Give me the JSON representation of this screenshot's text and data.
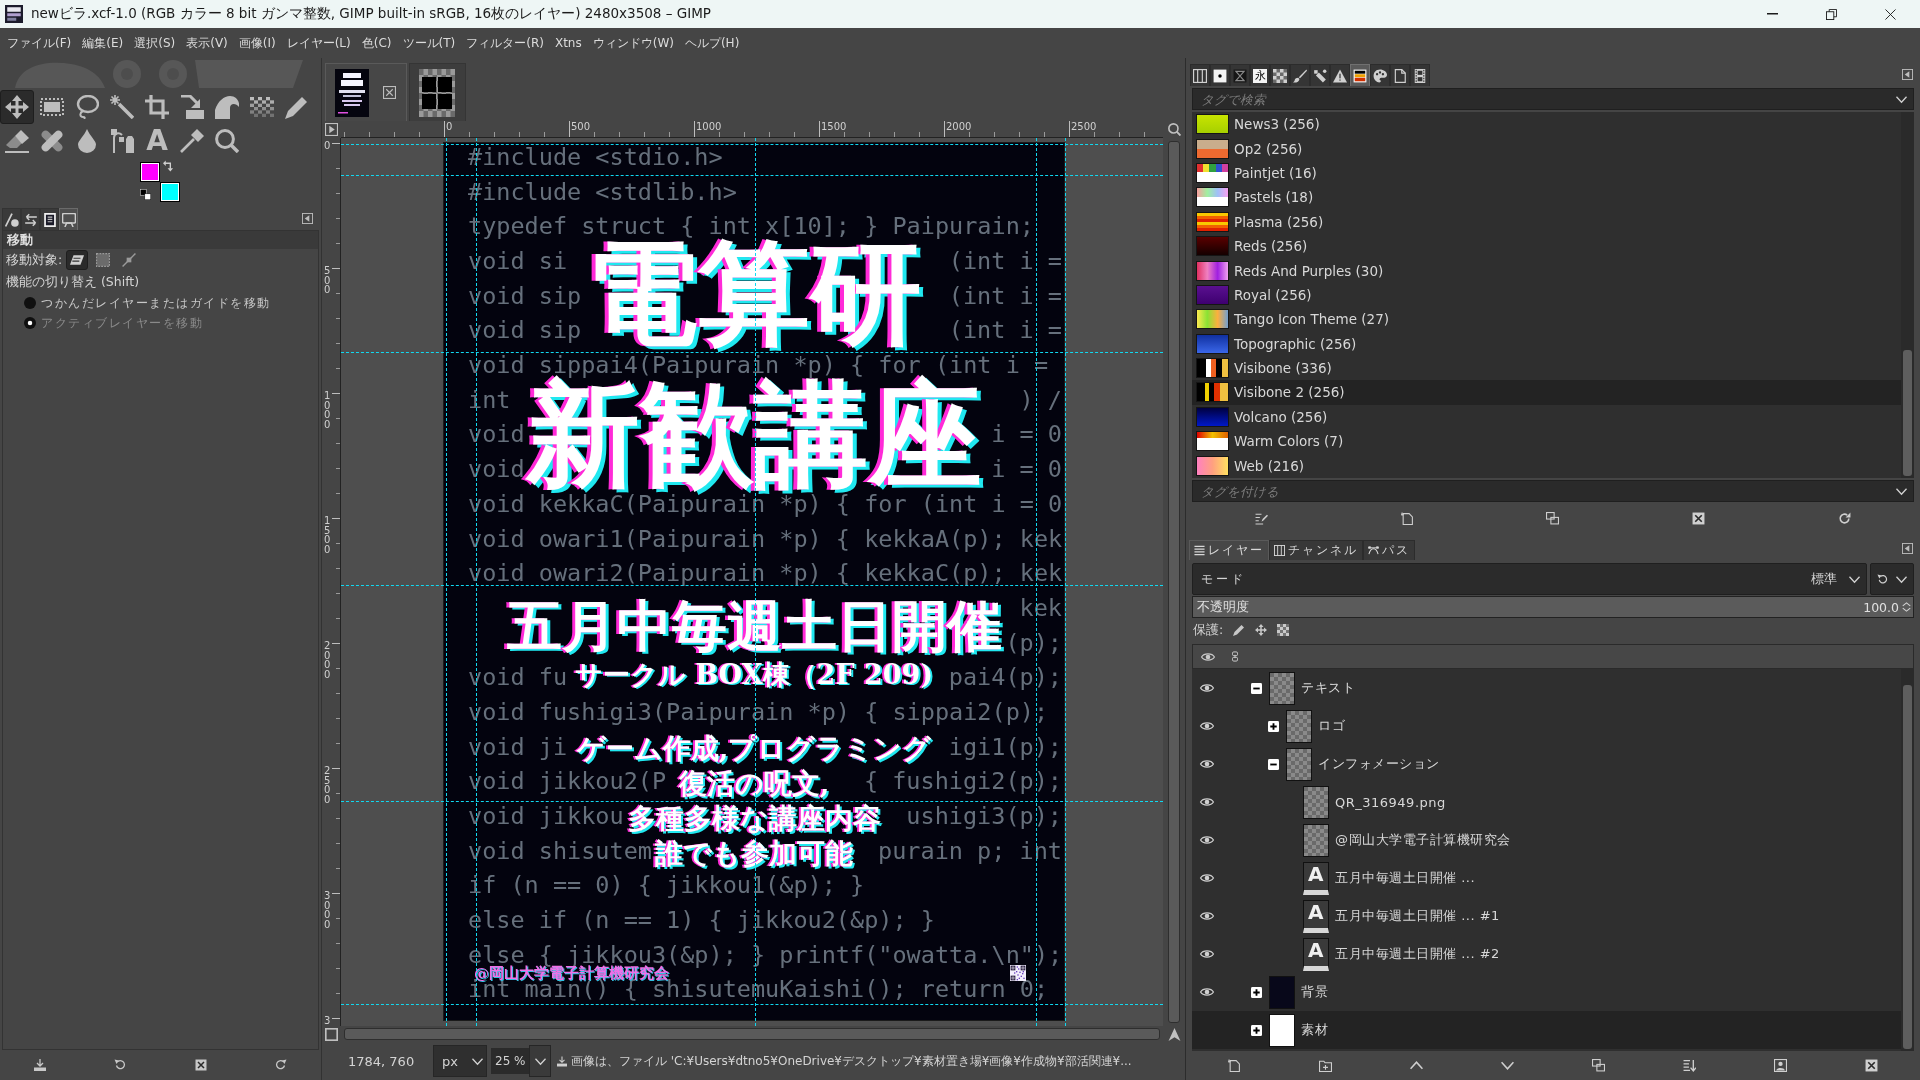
{
  "window": {
    "title": "newビラ.xcf-1.0 (RGB カラー 8 bit ガンマ整数, GIMP built-in sRGB, 16枚のレイヤー) 2480x3508 – GIMP"
  },
  "menu": [
    "ファイル(F)",
    "編集(E)",
    "選択(S)",
    "表示(V)",
    "画像(I)",
    "レイヤー(L)",
    "色(C)",
    "ツール(T)",
    "フィルター(R)",
    "Xtns",
    "ウィンドウ(W)",
    "ヘルプ(H)"
  ],
  "toolbox": {
    "tools": [
      {
        "selected": true
      },
      {
        "selected": false
      },
      {
        "selected": false
      },
      {
        "selected": false
      },
      {
        "selected": false
      },
      {
        "selected": false
      },
      {
        "selected": false
      },
      {
        "selected": false
      },
      {
        "selected": false
      },
      {
        "selected": false
      },
      {
        "selected": false
      },
      {
        "selected": false
      },
      {
        "selected": false
      },
      {
        "glyph": "A",
        "selected": false
      },
      {
        "selected": false
      },
      {
        "selected": false
      }
    ],
    "foreground": {
      "color": "#ff00ff"
    },
    "background": {
      "color": "#00ffff"
    }
  },
  "tool_options": {
    "tabs": [
      {
        "selected": false
      },
      {
        "selected": false
      },
      {
        "selected": false
      },
      {
        "selected": true
      }
    ],
    "title": "移動",
    "target_label": "移動対象:",
    "targets": [
      {
        "selected": true
      },
      {
        "selected": false
      },
      {
        "selected": false
      }
    ],
    "toggle_label": "機能の切り替え (Shift)",
    "modes": [
      {
        "label": "つかんだレイヤーまたはガイドを移動",
        "selected": false,
        "disabled": false
      },
      {
        "label": "アクティブレイヤーを移動",
        "selected": true,
        "disabled": true
      }
    ]
  },
  "image_tabs": [
    {
      "selected": true,
      "closable": true
    },
    {
      "selected": false,
      "closable": false
    }
  ],
  "rulers": {
    "horizontal": [
      "0",
      "500",
      "1000",
      "1500",
      "2000",
      "2500"
    ],
    "vertical": [
      "0",
      "500",
      "1000",
      "1500",
      "2000",
      "2500",
      "3000",
      "3"
    ]
  },
  "poster": {
    "code_lines": [
      {
        "left": "#include <stdio.h>"
      },
      {
        "left": "#include <stdlib.h>"
      },
      {
        "left": "typedef struct { int x[10]; } Paipurain;"
      },
      {
        "left": "void si",
        "right": "(int i ="
      },
      {
        "left": "void sip",
        "right": "(int i ="
      },
      {
        "left": "void sip",
        "right": "(int i ="
      },
      {
        "left": "void sippai4(Paipurain *p) { for (int i ="
      },
      {
        "left": "int",
        "right": ") /"
      },
      {
        "left": "void",
        "right": "i = 0"
      },
      {
        "left": "void",
        "right": "i = 0"
      },
      {
        "left": "void kekkaC(Paipurain *p) { for (int i = 0"
      },
      {
        "left": "void owari1(Paipurain *p) { kekkaA(p); kek"
      },
      {
        "left": "void owari2(Paipurain *p) { kekkaC(p); kek"
      },
      {
        "right": "kek"
      },
      {
        "right": "(p);"
      },
      {
        "left": "void fu",
        "right": "pai4(p);"
      },
      {
        "left": "void fushigi3(Paipurain *p) { sippai2(p);"
      },
      {
        "left": "void ji",
        "right": "igi1(p);"
      },
      {
        "left": "void jikkou2(P",
        "right": "{ fushigi2(p);"
      },
      {
        "left": "void jikkou",
        "right": "ushigi3(p);"
      },
      {
        "left": "void shisutem",
        "right": "purain p; int"
      },
      {
        "left": "if (n == 0) { jikkou1(&p); }"
      },
      {
        "left": "else if (n == 1) { jikkou2(&p); }"
      },
      {
        "left": "else { jikkou3(&p); } printf(\"owatta.\\n\");"
      },
      {
        "left": "int main() { shisutemuKaishi(); return 0;"
      }
    ],
    "title": [
      "電算研",
      "新歓講座"
    ],
    "schedule": "五月中毎週土日開催",
    "location": "サークル BOX棟（2F 209)",
    "info": [
      "ゲーム作成,プログラミング",
      "復活の呪文,",
      "多種多様な講座内容",
      "誰でも参加可能"
    ],
    "credit": "@岡山大学電子計算機研究会"
  },
  "status_bar": {
    "coords": "1784, 760",
    "unit": "px",
    "zoom": "25 %",
    "message": "画像は、ファイル 'C:¥Users¥dtno5¥OneDrive¥デスクトップ¥素材置き場¥画像¥作成物¥部活関連¥..."
  },
  "palettes": {
    "tabs": [
      {
        "selected": false
      },
      {
        "selected": false
      },
      {
        "selected": false
      },
      {
        "glyph": "永",
        "selected": false
      },
      {
        "selected": false
      },
      {
        "selected": false
      },
      {
        "selected": false
      },
      {
        "selected": false
      },
      {
        "selected": true
      },
      {
        "selected": false
      },
      {
        "selected": false
      },
      {
        "selected": false
      }
    ],
    "search": {
      "placeholder": "タグで検索"
    },
    "items": [
      {
        "name": "News3 (256)",
        "selected": false
      },
      {
        "name": "Op2 (256)",
        "selected": false
      },
      {
        "name": "Paintjet (16)",
        "selected": false
      },
      {
        "name": "Pastels (18)",
        "selected": false
      },
      {
        "name": "Plasma (256)",
        "selected": false
      },
      {
        "name": "Reds (256)",
        "selected": false
      },
      {
        "name": "Reds And Purples (30)",
        "selected": false
      },
      {
        "name": "Royal (256)",
        "selected": false
      },
      {
        "name": "Tango Icon Theme (27)",
        "selected": false
      },
      {
        "name": "Topographic (256)",
        "selected": false
      },
      {
        "name": "Visibone (336)",
        "selected": false
      },
      {
        "name": "Visibone 2 (256)",
        "selected": true
      },
      {
        "name": "Volcano (256)",
        "selected": false
      },
      {
        "name": "Warm Colors (7)",
        "selected": false
      },
      {
        "name": "Web (216)",
        "selected": false
      }
    ],
    "tag_field": {
      "placeholder": "タグを付ける"
    }
  },
  "layers": {
    "tabs": [
      {
        "label": "レイヤー",
        "selected": true
      },
      {
        "label": "チャンネル",
        "selected": false
      },
      {
        "label": "パス",
        "selected": false
      }
    ],
    "mode": {
      "label": "モード",
      "value": "標準"
    },
    "opacity": {
      "label": "不透明度",
      "value": "100.0",
      "level": 1
    },
    "lock_label": "保護:",
    "items": [
      {
        "name": "テキスト",
        "kind": "transparent",
        "visible": true,
        "selected": false,
        "expanded": true,
        "children": [
          {
            "name": "ロゴ",
            "kind": "transparent",
            "visible": true,
            "selected": false,
            "expanded": false
          },
          {
            "name": "インフォメーション",
            "kind": "transparent",
            "visible": true,
            "selected": false,
            "expanded": true,
            "children": [
              {
                "name": "QR_316949.png",
                "kind": "transparent",
                "visible": true,
                "selected": false
              },
              {
                "name": "@岡山大学電子計算機研究会",
                "kind": "transparent",
                "visible": true,
                "selected": false
              },
              {
                "name": "五月中毎週土日開催 ...",
                "kind": "text",
                "glyph": "A",
                "visible": true,
                "selected": false
              },
              {
                "name": "五月中毎週土日開催 ... #1",
                "kind": "text",
                "glyph": "A",
                "visible": true,
                "selected": false
              },
              {
                "name": "五月中毎週土日開催 ... #2",
                "kind": "text",
                "glyph": "A",
                "visible": true,
                "selected": false
              }
            ]
          }
        ]
      },
      {
        "name": "背景",
        "kind": "dark",
        "visible": true,
        "selected": false,
        "expanded": false
      },
      {
        "name": "素材",
        "kind": "light",
        "visible": false,
        "selected": true,
        "expanded": false
      }
    ]
  }
}
